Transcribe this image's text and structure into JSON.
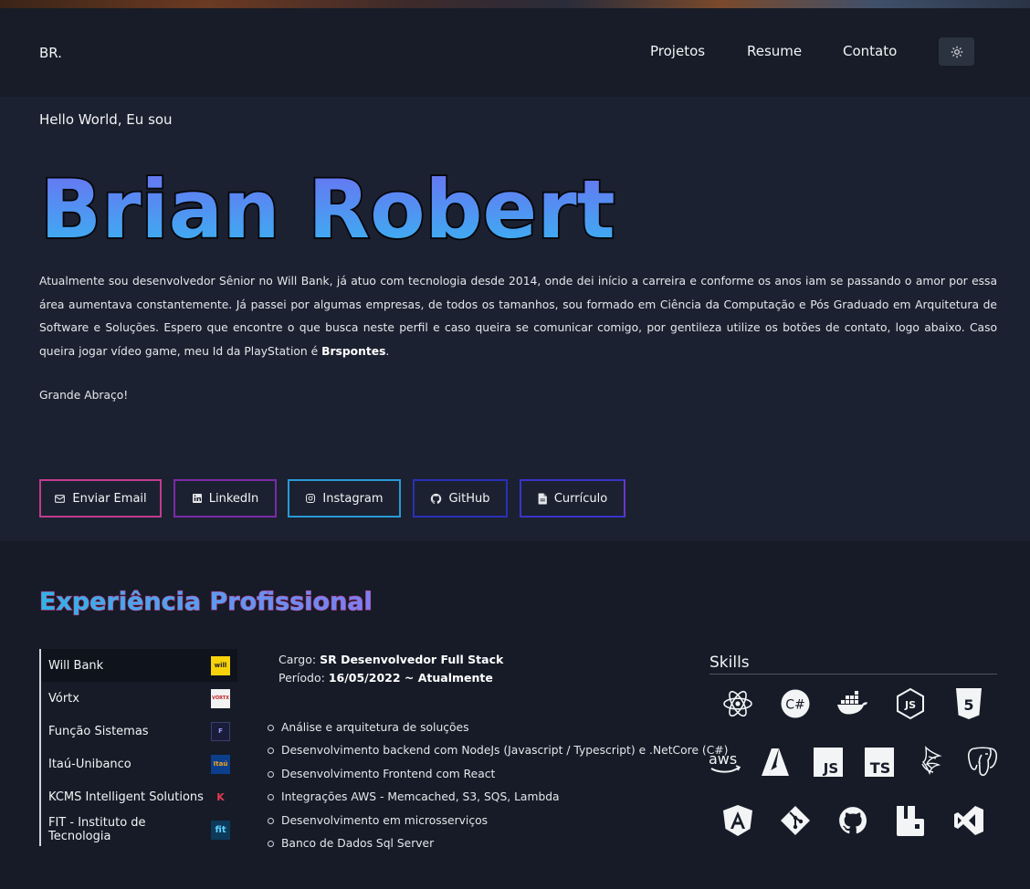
{
  "header": {
    "logo": "BR.",
    "nav": [
      "Projetos",
      "Resume",
      "Contato"
    ],
    "theme_icon": "sun-icon"
  },
  "hero": {
    "greeting": "Hello World, Eu sou",
    "name": "Brian Robert",
    "bio_before": "Atualmente sou desenvolvedor Sênior no Will Bank, já atuo com tecnologia desde 2014, onde dei início a carreira e conforme os anos iam se passando o amor por essa área aumentava constantemente. Já passei por algumas empresas, de todos os tamanhos, sou formado em Ciência da Computação e Pós Graduado em Arquitetura de Software e Soluções. Espero que encontre o que busca neste perfil e caso queira se comunicar comigo, por gentileza utilize os botões de contato, logo abaixo. Caso queira jogar vídeo game, meu Id da PlayStation é ",
    "psn_id": "Brspontes",
    "bio_after": ".",
    "farewell": "Grande Abraço!",
    "buttons": [
      {
        "label": "Enviar Email",
        "icon": "mail-icon",
        "border": "#c13b8d"
      },
      {
        "label": "LinkedIn",
        "icon": "linkedin-icon",
        "border": "#7a2aa8"
      },
      {
        "label": "Instagram",
        "icon": "instagram-icon",
        "border": "#2a9ad6"
      },
      {
        "label": "GitHub",
        "icon": "github-icon",
        "border": "#2a2fb8"
      },
      {
        "label": "Currículo",
        "icon": "document-icon",
        "border": "#3a34c8"
      }
    ]
  },
  "experience": {
    "title": "Experiência Profissional",
    "companies": [
      {
        "name": "Will Bank",
        "logo_text": "will",
        "logo_bg": "#f6d20a",
        "logo_fg": "#222"
      },
      {
        "name": "Vórtx",
        "logo_text": "VÓRTX",
        "logo_bg": "#f2f2f2",
        "logo_fg": "#c0282d"
      },
      {
        "name": "Função Sistemas",
        "logo_text": "F",
        "logo_bg": "#1a1d3a",
        "logo_fg": "#9aa0ff"
      },
      {
        "name": "Itaú-Unibanco",
        "logo_text": "Itaú",
        "logo_bg": "#0b3f8c",
        "logo_fg": "#f7a21b"
      },
      {
        "name": "KCMS Intelligent Solutions",
        "logo_text": "K",
        "logo_bg": "transparent",
        "logo_fg": "#e53b4e"
      },
      {
        "name": "FIT - Instituto de Tecnologia",
        "logo_text": "fit",
        "logo_bg": "#0c3a58",
        "logo_fg": "#5fd0ff"
      }
    ],
    "job": {
      "role_label": "Cargo:",
      "role": "SR Desenvolvedor Full Stack",
      "period_label": "Período:",
      "period": "16/05/2022 ~ Atualmente"
    },
    "tasks": [
      "Análise e arquitetura de soluções",
      "Desenvolvimento backend com NodeJs (Javascript / Typescript) e .NetCore (C#)",
      "Desenvolvimento Frontend com React",
      "Integrações AWS - Memcached, S3, SQS, Lambda",
      "Desenvolvimento em microsserviços",
      "Banco de Dados Sql Server"
    ]
  },
  "skills": {
    "title": "Skills",
    "icons": [
      "react-icon",
      "csharp-icon",
      "docker-icon",
      "nodejs-icon",
      "html5-icon",
      "aws-icon",
      "azure-icon",
      "javascript-icon",
      "typescript-icon",
      "sqlserver-icon",
      "postgresql-icon",
      "angular-icon",
      "git-icon",
      "github-icon",
      "rabbitmq-icon",
      "visualstudio-icon"
    ]
  }
}
